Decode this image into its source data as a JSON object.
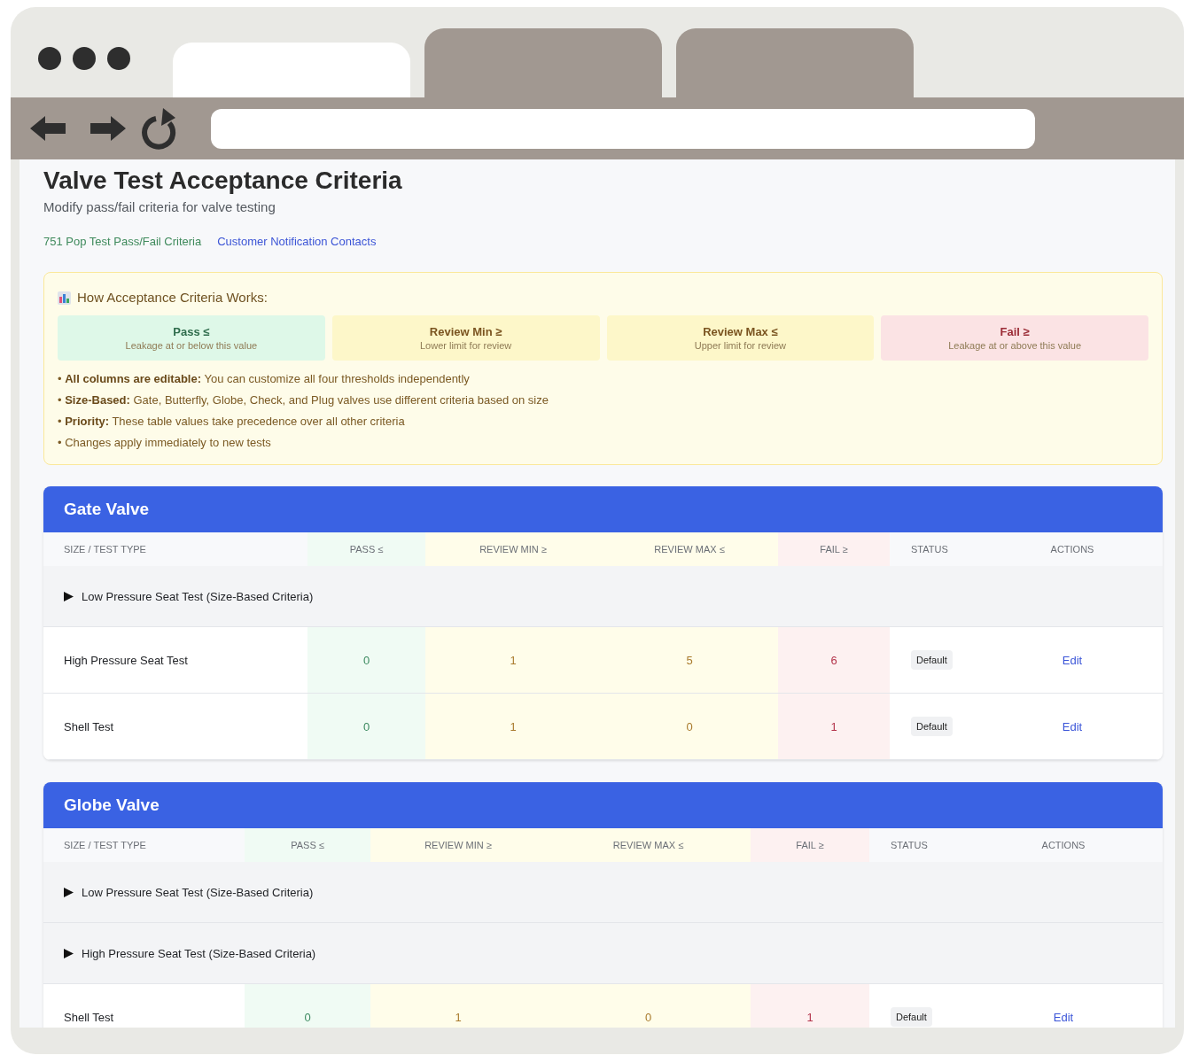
{
  "browser": {
    "tabs": [
      {
        "selected": true
      },
      {
        "selected": false
      },
      {
        "selected": false
      }
    ]
  },
  "page": {
    "title": "Valve Test Acceptance Criteria",
    "subtitle": "Modify pass/fail criteria for valve testing",
    "links": [
      {
        "label": "751 Pop Test Pass/Fail Criteria",
        "kind": "green"
      },
      {
        "label": "Customer Notification Contacts",
        "kind": "blue"
      }
    ]
  },
  "info": {
    "title": "How Acceptance Criteria Works:",
    "criteria": [
      {
        "kind": "pass",
        "title": "Pass ≤",
        "description": "Leakage at or below this value"
      },
      {
        "kind": "review",
        "title": "Review Min ≥",
        "description": "Lower limit for review"
      },
      {
        "kind": "review",
        "title": "Review Max ≤",
        "description": "Upper limit for review"
      },
      {
        "kind": "fail",
        "title": "Fail ≥",
        "description": "Leakage at or above this value"
      }
    ],
    "notes": [
      "• **All columns are editable:** You can customize all four thresholds independently",
      "• **Size-Based:** Gate, Butterfly, Globe, Check, and Plug valves use different criteria based on size",
      "• **Priority:** These table values take precedence over all other criteria",
      "• Changes apply immediately to new tests"
    ]
  },
  "tables": [
    {
      "title": "Gate Valve",
      "columns": [
        "SIZE / TEST TYPE",
        "PASS ≤",
        "REVIEW MIN ≥",
        "REVIEW MAX ≤",
        "FAIL ≥",
        "STATUS",
        "ACTIONS"
      ],
      "rows": [
        {
          "kind": "group",
          "label": "Low Pressure Seat Test (Size-Based Criteria)",
          "expanded": false
        },
        {
          "kind": "data",
          "test": "High Pressure Seat Test",
          "pass": "0",
          "review_min": "1",
          "review_max": "5",
          "fail": "6",
          "status": "Default",
          "action": "Edit"
        },
        {
          "kind": "data",
          "test": "Shell Test",
          "pass": "0",
          "review_min": "1",
          "review_max": "0",
          "fail": "1",
          "status": "Default",
          "action": "Edit"
        }
      ]
    },
    {
      "title": "Globe Valve",
      "columns": [
        "SIZE / TEST TYPE",
        "PASS ≤",
        "REVIEW MIN ≥",
        "REVIEW MAX ≤",
        "FAIL ≥",
        "STATUS",
        "ACTIONS"
      ],
      "rows": [
        {
          "kind": "group",
          "label": "Low Pressure Seat Test (Size-Based Criteria)",
          "expanded": false
        },
        {
          "kind": "group",
          "label": "High Pressure Seat Test (Size-Based Criteria)",
          "expanded": false
        },
        {
          "kind": "data",
          "test": "Shell Test",
          "pass": "0",
          "review_min": "1",
          "review_max": "0",
          "fail": "1",
          "status": "Default",
          "action": "Edit"
        }
      ]
    }
  ]
}
